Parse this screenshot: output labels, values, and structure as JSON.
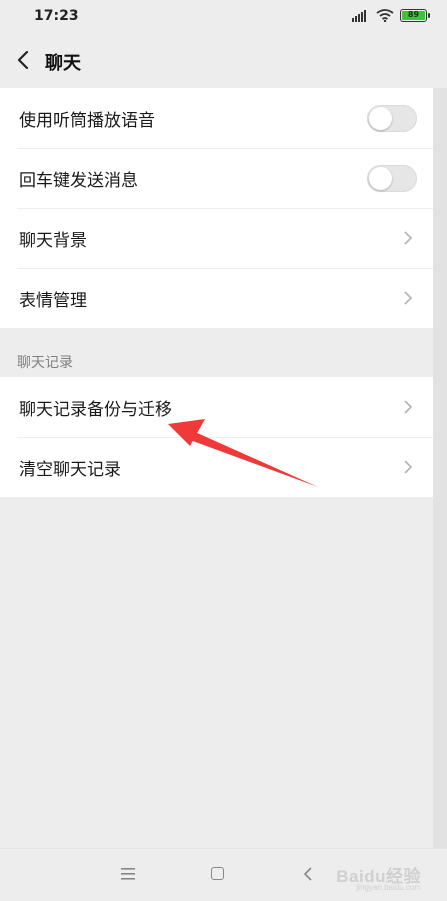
{
  "status_bar": {
    "time": "17:23",
    "battery": "89",
    "icons": [
      "signal-icon",
      "wifi-icon",
      "battery-icon"
    ]
  },
  "nav": {
    "title": "聊天",
    "back_icon": "chevron-left-icon"
  },
  "settings_group_1": {
    "items": [
      {
        "label": "使用听筒播放语音",
        "control": "toggle",
        "enabled": false
      },
      {
        "label": "回车键发送消息",
        "control": "toggle",
        "enabled": false
      },
      {
        "label": "聊天背景",
        "control": "chevron"
      },
      {
        "label": "表情管理",
        "control": "chevron"
      }
    ]
  },
  "section_header": "聊天记录",
  "settings_group_2": {
    "items": [
      {
        "label": "聊天记录备份与迁移",
        "control": "chevron"
      },
      {
        "label": "清空聊天记录",
        "control": "chevron"
      }
    ]
  },
  "system_nav": {
    "icons": [
      "menu-icon",
      "home-icon",
      "back-icon"
    ]
  },
  "watermark": {
    "text": "Baidu经验",
    "sub": "jingyan.baidu.com"
  },
  "colors": {
    "background": "#ededed",
    "toggle_off": "#e6e6e6",
    "annotation_arrow": "#f03a3a"
  }
}
